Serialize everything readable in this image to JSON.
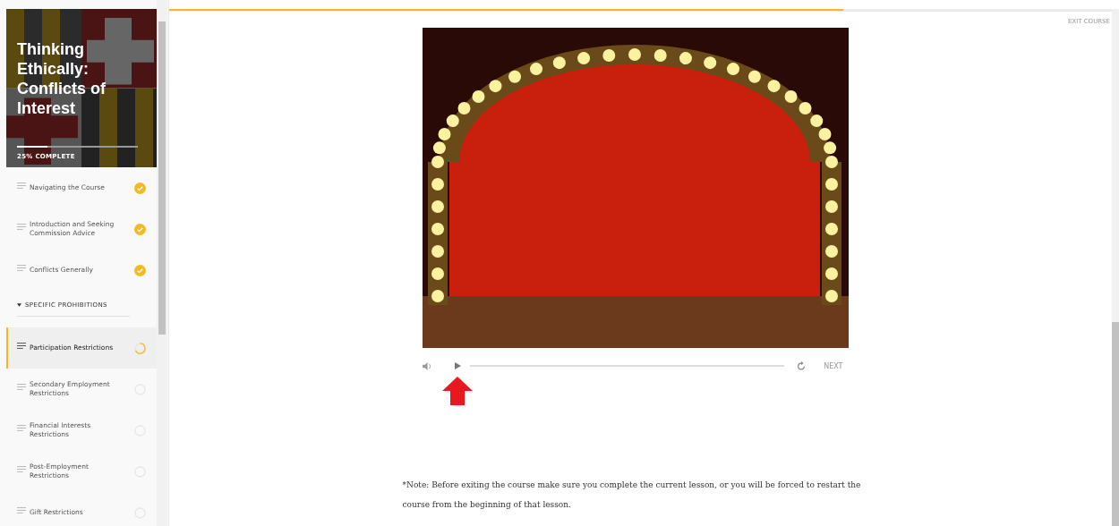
{
  "course": {
    "title": "Thinking Ethically: Conflicts of Interest",
    "progress": {
      "level": 0.25,
      "label": "25% COMPLETE"
    }
  },
  "lessons": [
    {
      "kind": "lesson",
      "title": "Navigating the Course",
      "completed": true,
      "selected": false
    },
    {
      "kind": "lesson",
      "title": "Introduction and Seeking Commission Advice",
      "completed": true,
      "selected": false
    },
    {
      "kind": "lesson",
      "title": "Conflicts Generally",
      "completed": true,
      "selected": false
    },
    {
      "kind": "section",
      "title": "SPECIFIC PROHIBITIONS",
      "expanded": true
    },
    {
      "kind": "lesson",
      "title": "Participation Restrictions",
      "completed": false,
      "started": true,
      "selected": true
    },
    {
      "kind": "lesson",
      "title": "Secondary Employment Restrictions",
      "completed": false,
      "started": false,
      "selected": false
    },
    {
      "kind": "lesson",
      "title": "Financial Interests Restrictions",
      "completed": false,
      "started": false,
      "selected": false
    },
    {
      "kind": "lesson",
      "title": "Post-Employment Restrictions",
      "completed": false,
      "started": false,
      "selected": false
    },
    {
      "kind": "lesson",
      "title": "Gift Restrictions",
      "completed": false,
      "started": false,
      "selected": false
    }
  ],
  "lesson_progress": {
    "level": 0.71
  },
  "exit_label": "EXIT COURSE",
  "player": {
    "next_label": "NEXT"
  },
  "note": "*Note: Before exiting the course make sure you complete the current lesson, or you will be forced to restart the course from the beginning of that lesson."
}
